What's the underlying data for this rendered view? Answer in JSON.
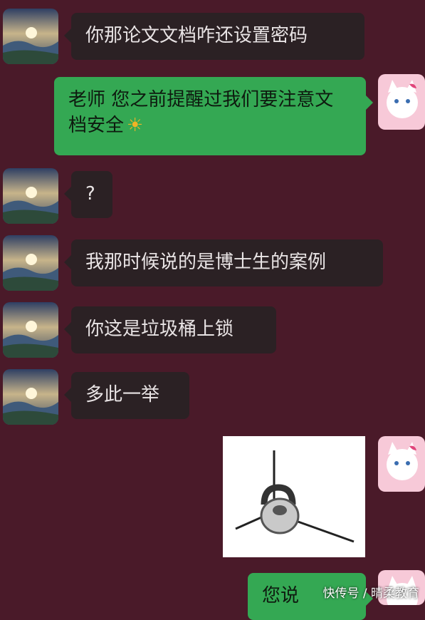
{
  "messages": [
    {
      "side": "in",
      "text": "你那论文文档咋还设置密码"
    },
    {
      "side": "out",
      "text": "老师 您之前提醒过我们要注意文档安全",
      "emoji": "sun-emoji"
    },
    {
      "side": "in",
      "text": "?"
    },
    {
      "side": "in",
      "text": "我那时候说的是博士生的案例"
    },
    {
      "side": "in",
      "text": "你这是垃圾桶上锁"
    },
    {
      "side": "in",
      "text": "多此一举"
    },
    {
      "side": "out",
      "type": "sticker",
      "sticker": "lock-sticker"
    },
    {
      "side": "out",
      "text": "您说",
      "partial": true
    }
  ],
  "watermark": "快传号 / 晴柔教育",
  "colors": {
    "background": "#4a1a29",
    "incoming_bubble": "#2b2124",
    "outgoing_bubble": "#34a853"
  }
}
